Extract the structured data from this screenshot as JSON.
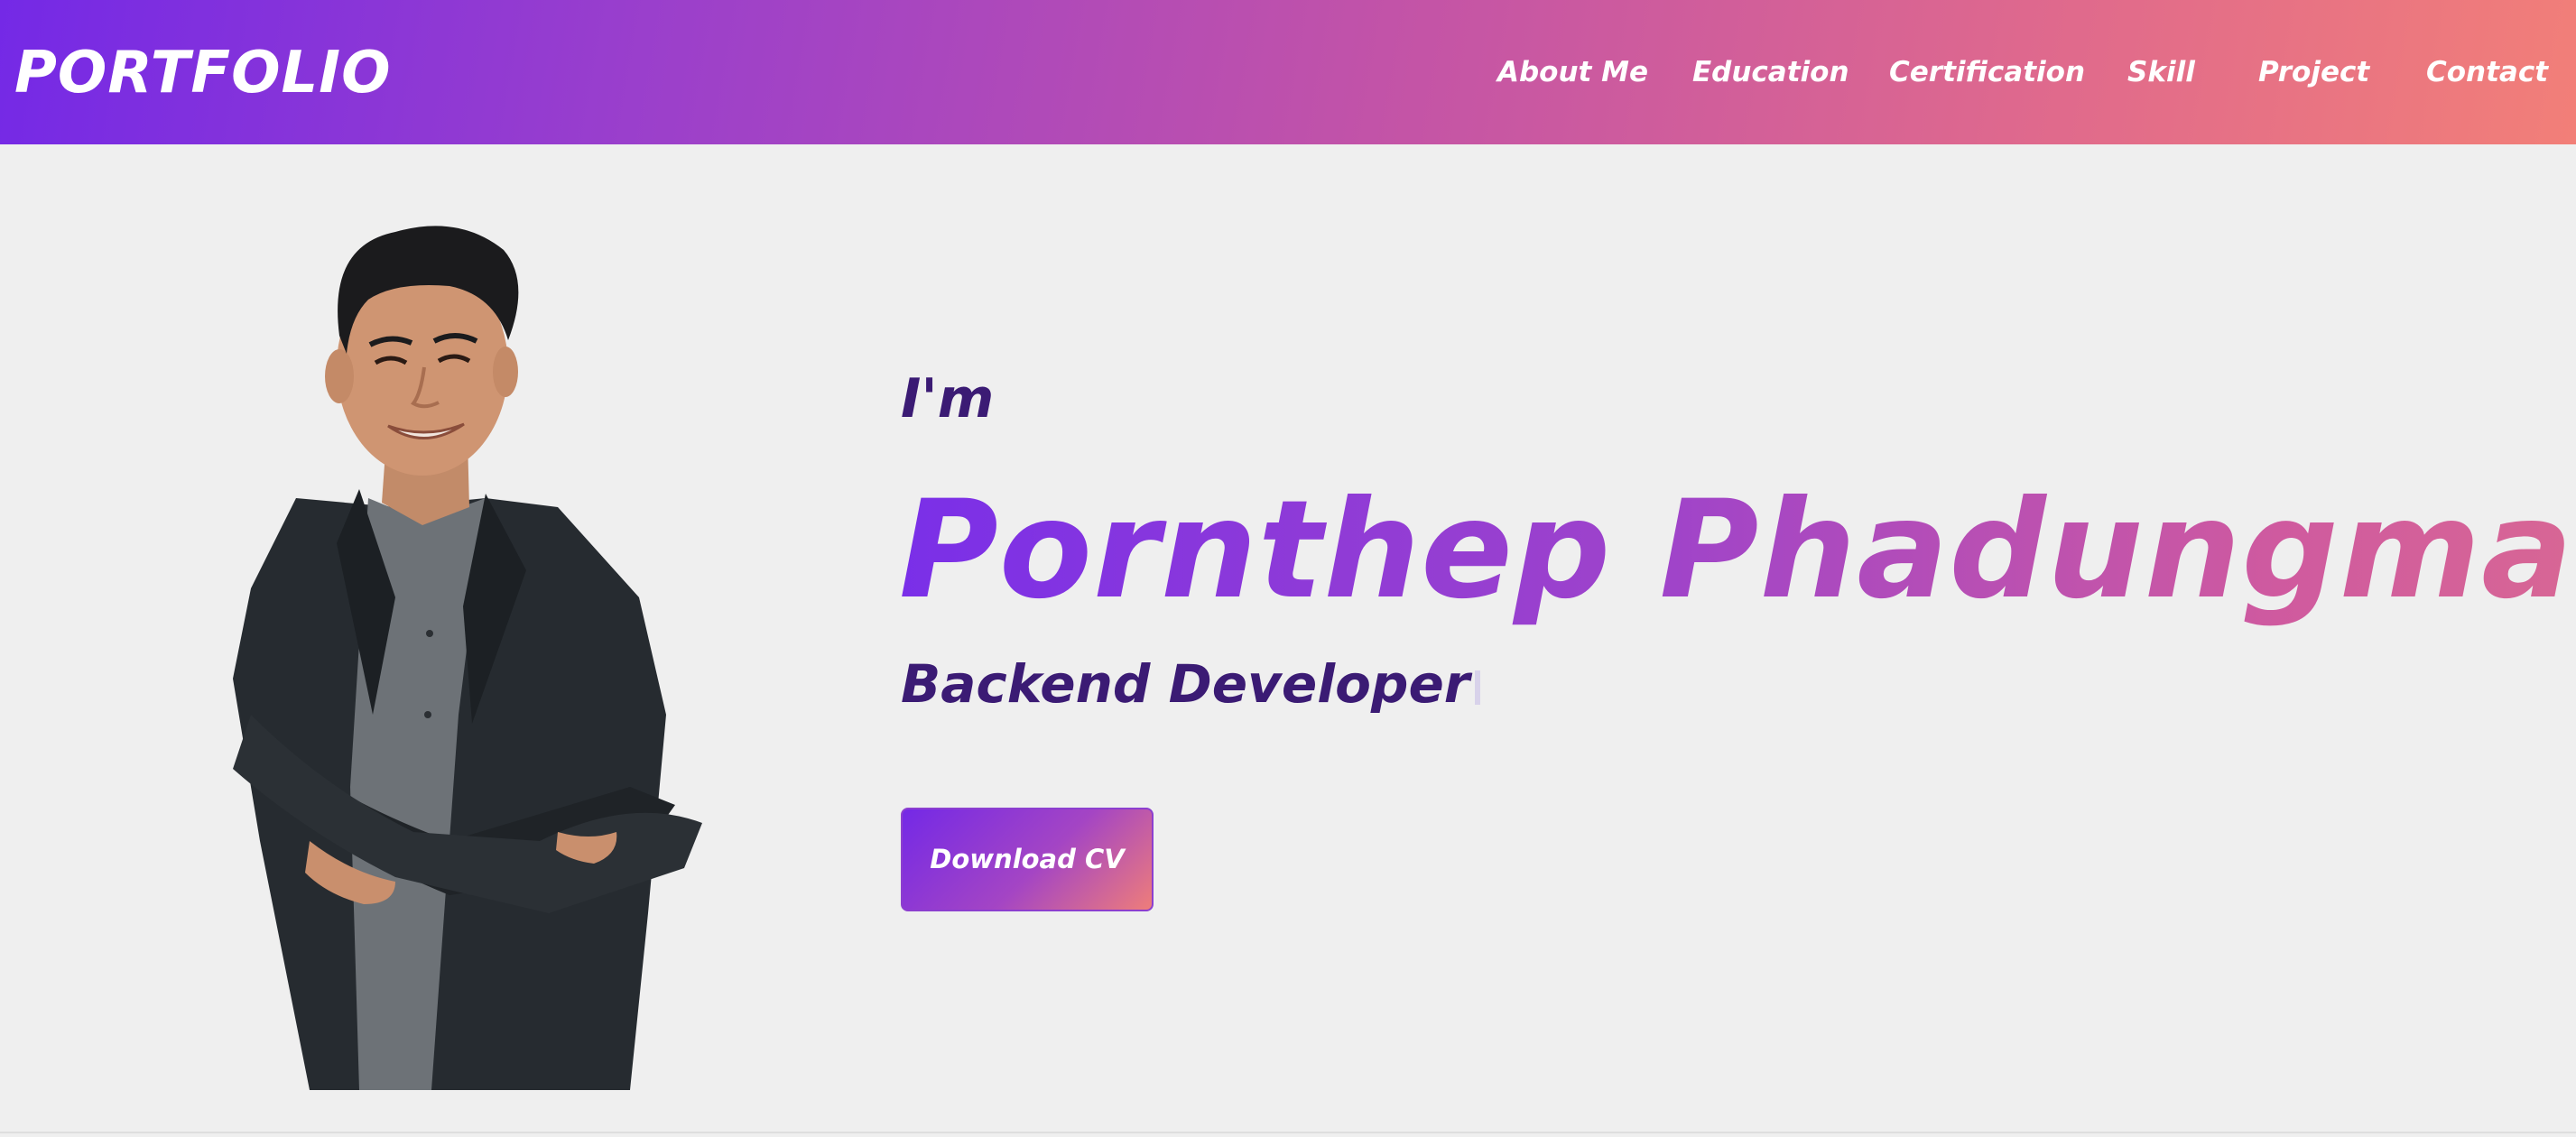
{
  "navbar": {
    "brand": "PORTFOLIO",
    "links": [
      {
        "label": "About Me"
      },
      {
        "label": "Education"
      },
      {
        "label": "Certification"
      },
      {
        "label": "Skill"
      },
      {
        "label": "Project"
      },
      {
        "label": "Contact"
      }
    ]
  },
  "hero": {
    "intro": "I'm",
    "name": "Pornthep Phadungmai",
    "role": "Backend Developer",
    "download_label": "Download CV",
    "photo_icon": "portrait-photo"
  },
  "colors": {
    "gradient_start": "#7429e6",
    "gradient_end": "#f27f78",
    "text_dark_purple": "#3b1b74",
    "background": "#efefef"
  }
}
